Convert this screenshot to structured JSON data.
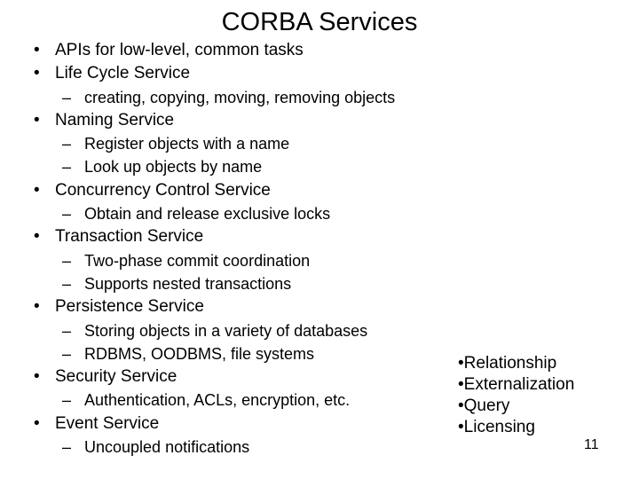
{
  "slide": {
    "title": "CORBA Services",
    "page_number": "11",
    "background_color": "#ffffff",
    "text_color": "#000000",
    "level1_bullet_glyph": "•",
    "level2_bullet_glyph": "–",
    "outline": [
      {
        "level": 1,
        "text": "APIs for low-level, common tasks"
      },
      {
        "level": 1,
        "text": "Life Cycle Service"
      },
      {
        "level": 2,
        "text": "creating, copying, moving, removing objects"
      },
      {
        "level": 1,
        "text": "Naming Service"
      },
      {
        "level": 2,
        "text": "Register objects with a name"
      },
      {
        "level": 2,
        "text": "Look up objects by name"
      },
      {
        "level": 1,
        "text": "Concurrency Control Service"
      },
      {
        "level": 2,
        "text": "Obtain and release exclusive locks"
      },
      {
        "level": 1,
        "text": "Transaction Service"
      },
      {
        "level": 2,
        "text": "Two-phase commit coordination"
      },
      {
        "level": 2,
        "text": "Supports nested transactions"
      },
      {
        "level": 1,
        "text": "Persistence Service"
      },
      {
        "level": 2,
        "text": "Storing objects in a variety of databases"
      },
      {
        "level": 2,
        "text": "RDBMS, OODBMS, file systems"
      },
      {
        "level": 1,
        "text": "Security Service"
      },
      {
        "level": 2,
        "text": "Authentication, ACLs, encryption, etc."
      },
      {
        "level": 1,
        "text": "Event Service"
      },
      {
        "level": 2,
        "text": "Uncoupled notifications"
      }
    ],
    "side_box": {
      "bullet_glyph": "•",
      "items": [
        {
          "text": "Relationship"
        },
        {
          "text": "Externalization"
        },
        {
          "text": "Query"
        },
        {
          "text": "Licensing"
        }
      ]
    }
  }
}
